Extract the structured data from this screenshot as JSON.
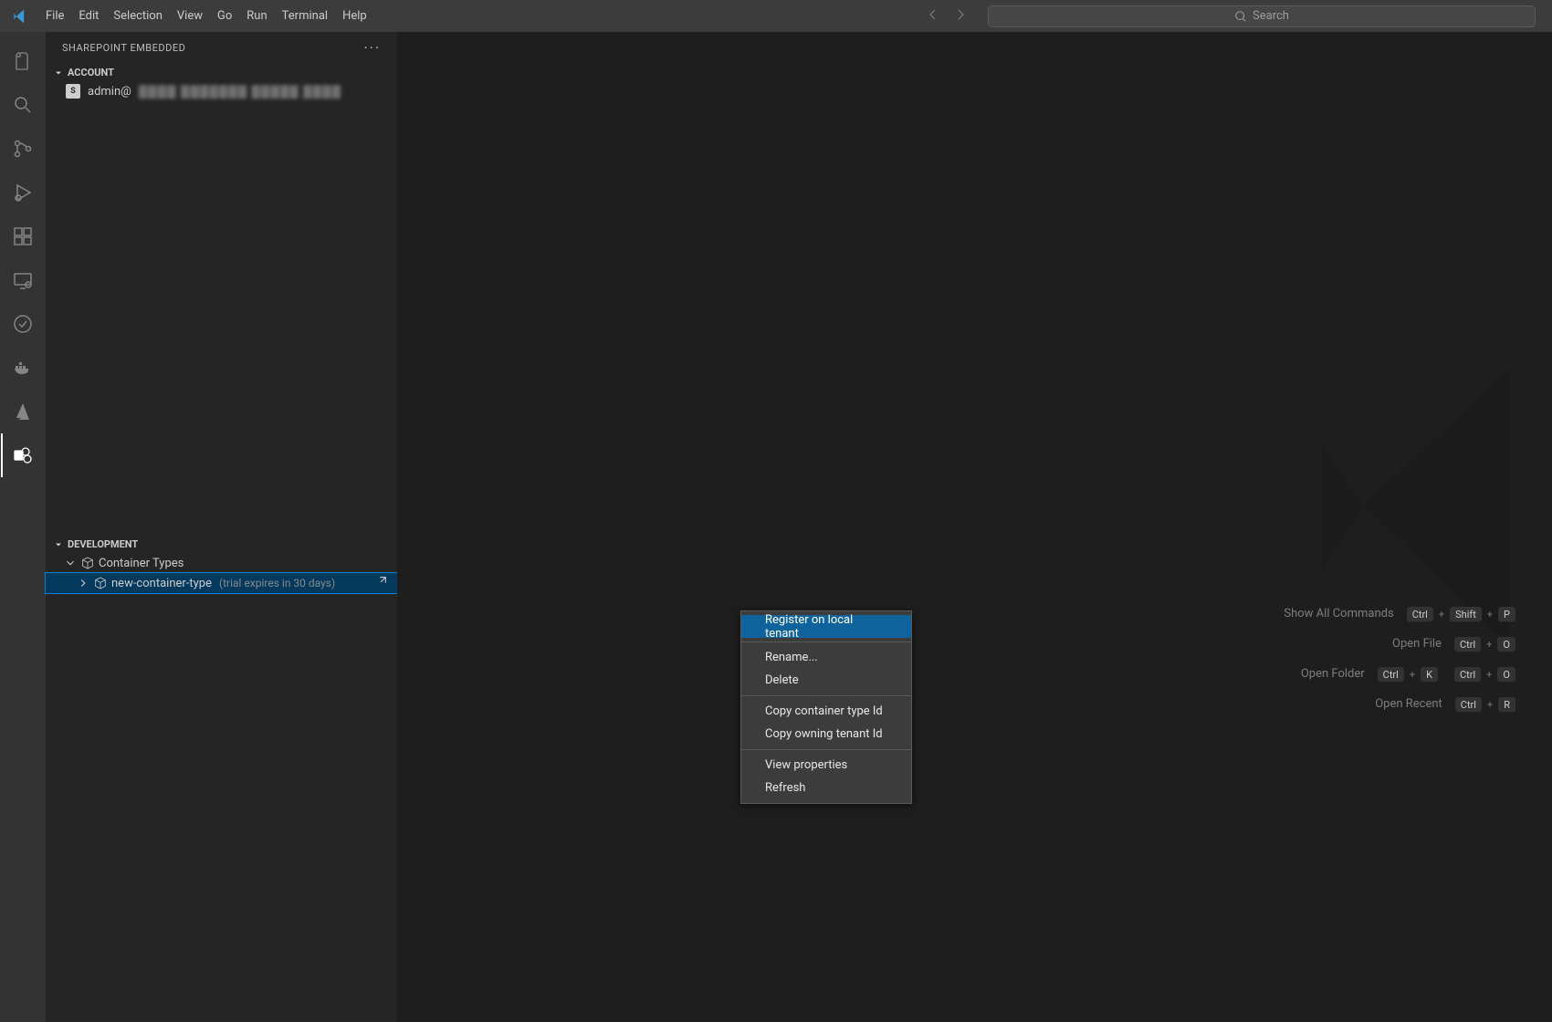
{
  "menubar": [
    "File",
    "Edit",
    "Selection",
    "View",
    "Go",
    "Run",
    "Terminal",
    "Help"
  ],
  "search_placeholder": "Search",
  "sidebar": {
    "title": "SHAREPOINT EMBEDDED",
    "sections": {
      "account": {
        "header": "ACCOUNT",
        "entry_prefix": "admin@",
        "entry_blur": "▓▓▓▓ ▓▓▓▓▓▓▓ ▓▓▓▓▓ ▓▓▓▓"
      },
      "development": {
        "header": "DEVELOPMENT",
        "container_types_label": "Container Types",
        "item_name": "new-container-type",
        "item_note": "(trial expires in 30 days)"
      }
    }
  },
  "context_menu": {
    "groups": [
      [
        "Register on local tenant"
      ],
      [
        "Rename...",
        "Delete"
      ],
      [
        "Copy container type Id",
        "Copy owning tenant Id"
      ],
      [
        "View properties",
        "Refresh"
      ]
    ],
    "highlighted": "Register on local tenant"
  },
  "shortcuts": [
    {
      "label": "Show All Commands",
      "keys": [
        "Ctrl",
        "Shift",
        "P"
      ]
    },
    {
      "label": "Open File",
      "keys": [
        "Ctrl",
        "O"
      ]
    },
    {
      "label": "Open Folder",
      "keys": [
        "Ctrl",
        "K",
        "Ctrl",
        "O"
      ]
    },
    {
      "label": "Open Recent",
      "keys": [
        "Ctrl",
        "R"
      ]
    }
  ],
  "activity_icons": [
    "files-icon",
    "search-icon",
    "source-control-icon",
    "run-debug-icon",
    "extensions-icon",
    "remote-icon",
    "testing-icon",
    "docker-icon",
    "azure-icon",
    "sharepoint-icon"
  ]
}
